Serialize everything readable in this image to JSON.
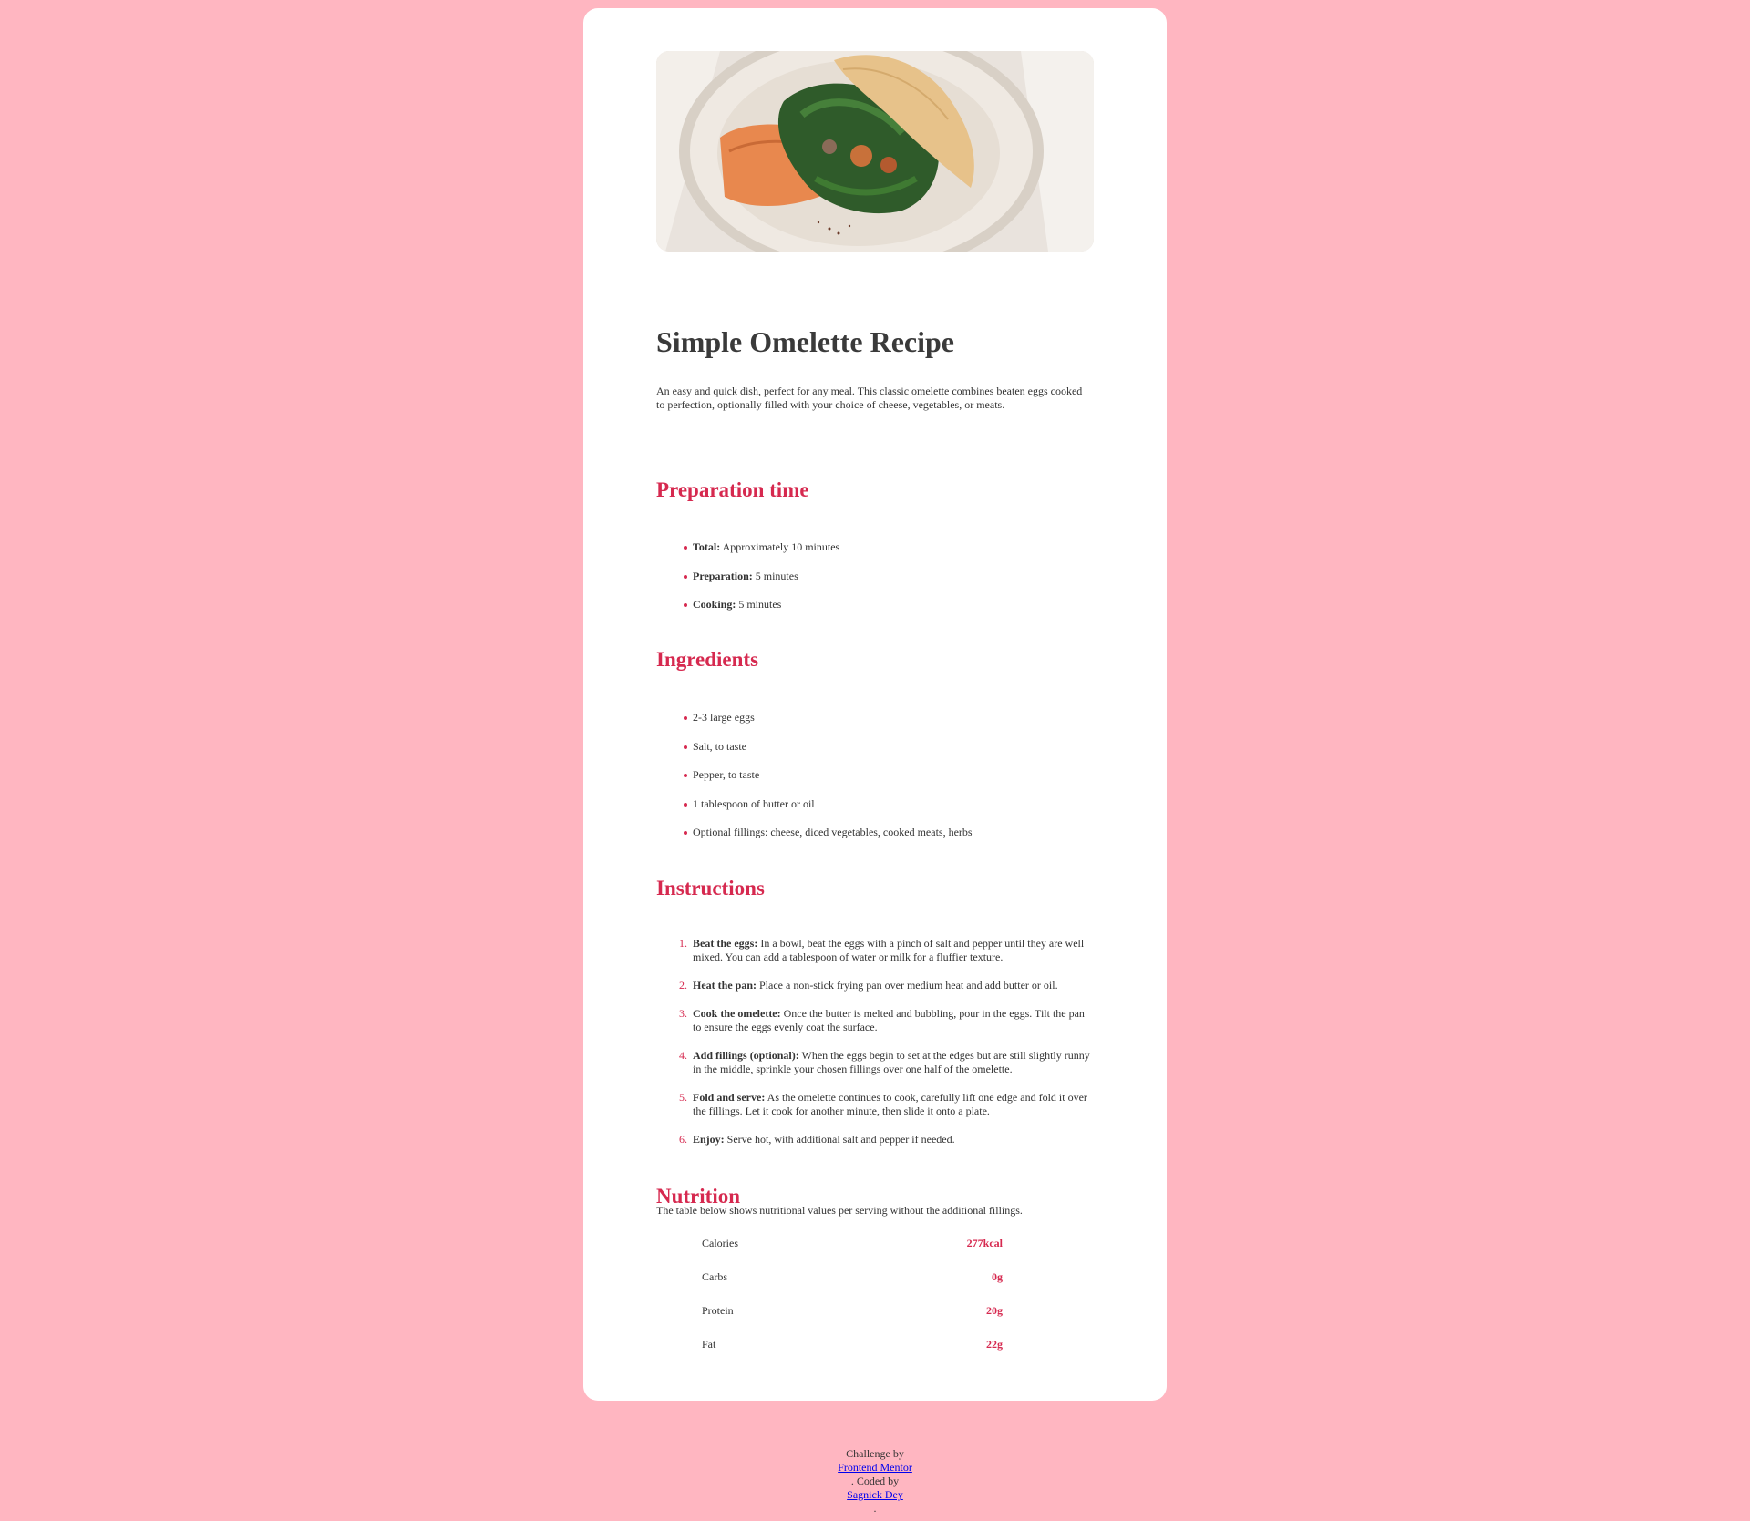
{
  "recipe": {
    "title": "Simple Omelette Recipe",
    "intro": "An easy and quick dish, perfect for any meal. This classic omelette combines beaten eggs cooked to perfection, optionally filled with your choice of cheese, vegetables, or meats.",
    "accent_color": "#d6294f",
    "background_color": "#ffb6c1",
    "image_icon": "omelette-photo"
  },
  "prep": {
    "heading": "Preparation time",
    "items": [
      {
        "label": "Total:",
        "text": " Approximately 10 minutes"
      },
      {
        "label": "Preparation:",
        "text": " 5 minutes"
      },
      {
        "label": "Cooking:",
        "text": " 5 minutes"
      }
    ]
  },
  "ingredients": {
    "heading": "Ingredients",
    "items": [
      "2-3 large eggs",
      "Salt, to taste",
      "Pepper, to taste",
      "1 tablespoon of butter or oil",
      "Optional fillings: cheese, diced vegetables, cooked meats, herbs"
    ]
  },
  "instructions": {
    "heading": "Instructions",
    "items": [
      {
        "num": "1.",
        "label": "Beat the eggs:",
        "text": " In a bowl, beat the eggs with a pinch of salt and pepper until they are well mixed. You can add a tablespoon of water or milk for a fluffier texture."
      },
      {
        "num": "2.",
        "label": "Heat the pan:",
        "text": " Place a non-stick frying pan over medium heat and add butter or oil."
      },
      {
        "num": "3.",
        "label": "Cook the omelette:",
        "text": " Once the butter is melted and bubbling, pour in the eggs. Tilt the pan to ensure the eggs evenly coat the surface."
      },
      {
        "num": "4.",
        "label": "Add fillings (optional):",
        "text": " When the eggs begin to set at the edges but are still slightly runny in the middle, sprinkle your chosen fillings over one half of the omelette."
      },
      {
        "num": "5.",
        "label": "Fold and serve:",
        "text": " As the omelette continues to cook, carefully lift one edge and fold it over the fillings. Let it cook for another minute, then slide it onto a plate."
      },
      {
        "num": "6.",
        "label": "Enjoy:",
        "text": " Serve hot, with additional salt and pepper if needed."
      }
    ]
  },
  "nutrition": {
    "heading": "Nutrition",
    "intro": "The table below shows nutritional values per serving without the additional fillings.",
    "rows": [
      {
        "label": "Calories",
        "value": "277kcal"
      },
      {
        "label": "Carbs",
        "value": "0g"
      },
      {
        "label": "Protein",
        "value": "20g"
      },
      {
        "label": "Fat",
        "value": "22g"
      }
    ]
  },
  "footer": {
    "challenge_by": "Challenge by",
    "fm_link": "Frontend Mentor",
    "coded_by": ". Coded by",
    "author_link": "Sagnick Dey",
    "end": "."
  }
}
